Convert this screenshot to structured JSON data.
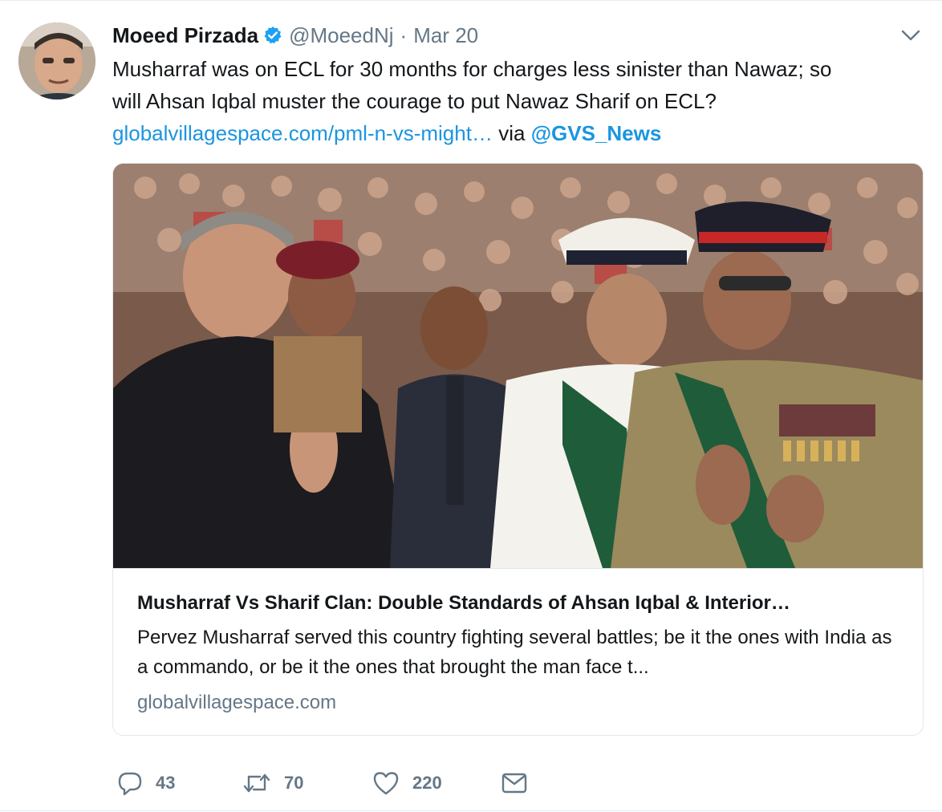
{
  "author": {
    "name": "Moeed Pirzada",
    "handle": "@MoeedNj",
    "separator": "·",
    "date": "Mar 20"
  },
  "tweet": {
    "text_line1": "Musharraf was on ECL for 30 months for charges less sinister than Nawaz; so",
    "text_line2": "will Ahsan Iqbal muster the courage to put Nawaz Sharif on ECL?",
    "link_text": "globalvillagespace.com/pml-n-vs-might…",
    "via_text": "via",
    "mention": "@GVS_News"
  },
  "card": {
    "title": "Musharraf Vs Sharif Clan: Double Standards of Ahsan Iqbal & Interior…",
    "description": "Pervez Musharraf served this country fighting several battles; be it the ones with India as a commando, or be it the ones that brought the man face t...",
    "domain": "globalvillagespace.com"
  },
  "actions": {
    "reply_count": "43",
    "retweet_count": "70",
    "like_count": "220"
  },
  "icons": {
    "verified": "verified-badge-icon",
    "caret": "chevron-down-icon",
    "reply": "reply-icon",
    "retweet": "retweet-icon",
    "like": "heart-icon",
    "message": "envelope-icon"
  },
  "colors": {
    "link": "#1b95e0",
    "secondary_text": "#657786",
    "border": "#e1e8ed",
    "verified": "#1da1f2"
  }
}
